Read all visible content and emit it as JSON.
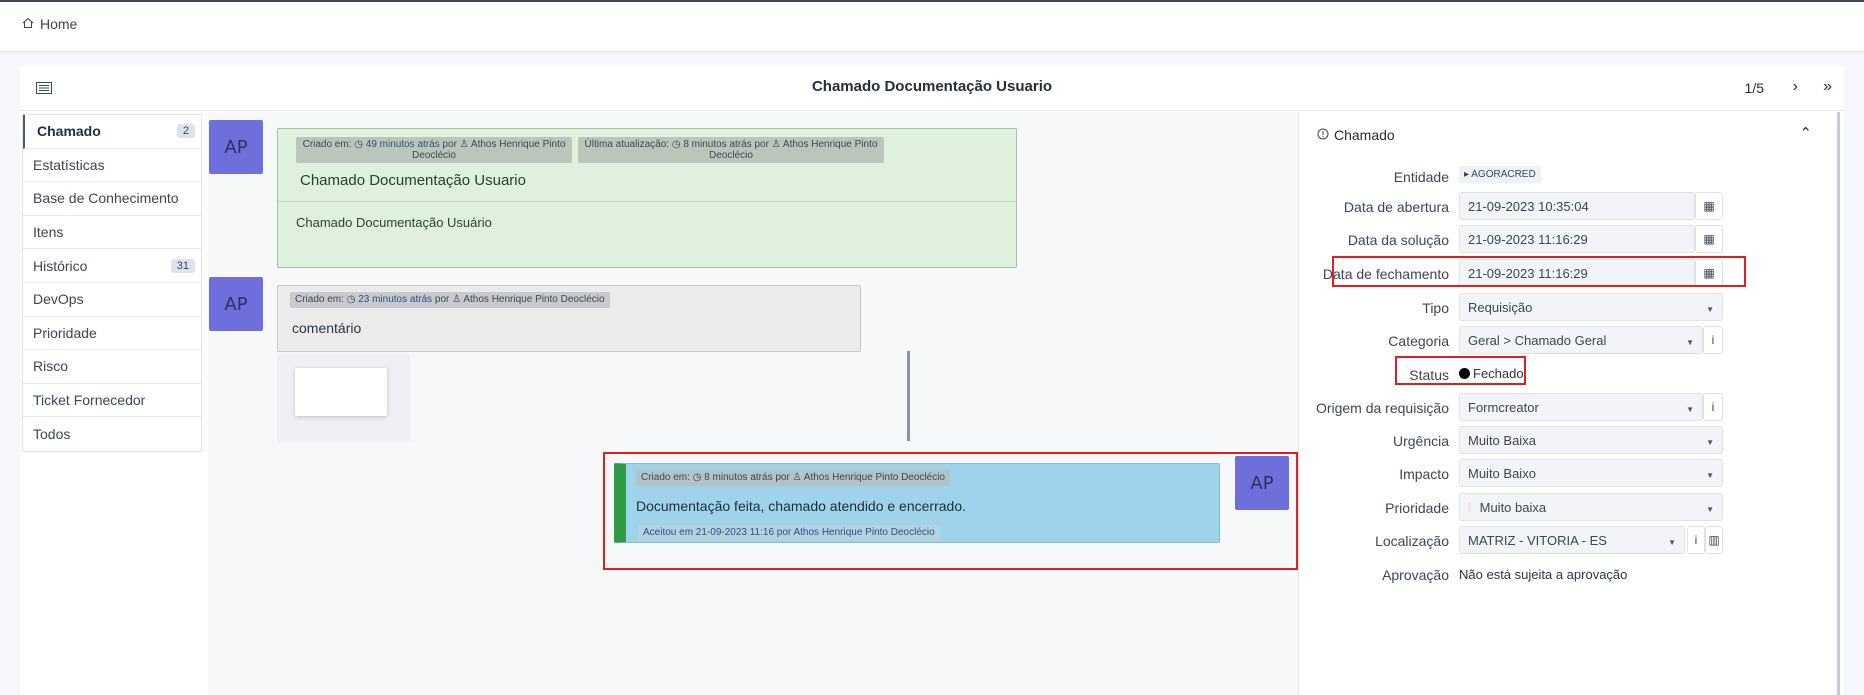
{
  "breadcrumb": {
    "home_label": "Home"
  },
  "header": {
    "title": "Chamado Documentação Usuario",
    "pager": "1/5"
  },
  "nav": {
    "items": [
      {
        "label": "Chamado",
        "badge": "2"
      },
      {
        "label": "Estatísticas",
        "badge": ""
      },
      {
        "label": "Base de Conhecimento",
        "badge": ""
      },
      {
        "label": "Itens",
        "badge": ""
      },
      {
        "label": "Histórico",
        "badge": "31"
      },
      {
        "label": "DevOps",
        "badge": ""
      },
      {
        "label": "Prioridade",
        "badge": ""
      },
      {
        "label": "Risco",
        "badge": ""
      },
      {
        "label": "Ticket Fornecedor",
        "badge": ""
      },
      {
        "label": "Todos",
        "badge": ""
      }
    ]
  },
  "timeline": {
    "ticket": {
      "avatar": "AP",
      "created_prefix": "Criado em:",
      "created_time": "49 minutos atrás",
      "created_by": "por",
      "created_author": "Athos Henrique Pinto Deoclécio",
      "updated_prefix": "Última atualização:",
      "updated_time": "8 minutos atrás",
      "updated_by": "por",
      "updated_author": "Athos Henrique Pinto Deoclécio",
      "title": "Chamado Documentação Usuario",
      "body": "Chamado Documentação Usuário"
    },
    "comment": {
      "avatar": "AP",
      "created_prefix": "Criado em:",
      "created_time": "23 minutos atrás",
      "created_by": "por",
      "author": "Athos Henrique Pinto Deoclécio",
      "body": "comentário"
    },
    "solution": {
      "avatar": "AP",
      "created_prefix": "Criado em:",
      "created_time": "8 minutos atrás",
      "created_by": "por",
      "author": "Athos Henrique Pinto Deoclécio",
      "body": "Documentação feita, chamado atendido e encerrado.",
      "accepted": "Aceitou em 21-09-2023 11:16 por Athos Henrique Pinto Deoclécio"
    }
  },
  "panel": {
    "section_title": "Chamado",
    "fields": {
      "entidade_label": "Entidade",
      "entidade_value": "AGORACRED",
      "abertura_label": "Data de abertura",
      "abertura_value": "21-09-2023 10:35:04",
      "solucao_label": "Data da solução",
      "solucao_value": "21-09-2023 11:16:29",
      "fechamento_label": "Data de fechamento",
      "fechamento_value": "21-09-2023 11:16:29",
      "tipo_label": "Tipo",
      "tipo_value": "Requisição",
      "categoria_label": "Categoria",
      "categoria_value": "Geral > Chamado Geral",
      "status_label": "Status",
      "status_value": "Fechado",
      "origem_label": "Origem da requisição",
      "origem_value": "Formcreator",
      "urgencia_label": "Urgência",
      "urgencia_value": "Muito Baixa",
      "impacto_label": "Impacto",
      "impacto_value": "Muito Baixo",
      "prioridade_label": "Prioridade",
      "prioridade_value": "Muito baixa",
      "localizacao_label": "Localização",
      "localizacao_value": "MATRIZ - VITORIA - ES",
      "aprovacao_label": "Aprovação",
      "aprovacao_value": "Não está sujeita a aprovação"
    }
  },
  "colors": {
    "ticket_bg": "#dff0df",
    "comment_bg": "#ebebeb",
    "solution_bg": "#9fd3eb",
    "avatar_bg": "#6f6fdc",
    "highlight": "#e02020"
  }
}
